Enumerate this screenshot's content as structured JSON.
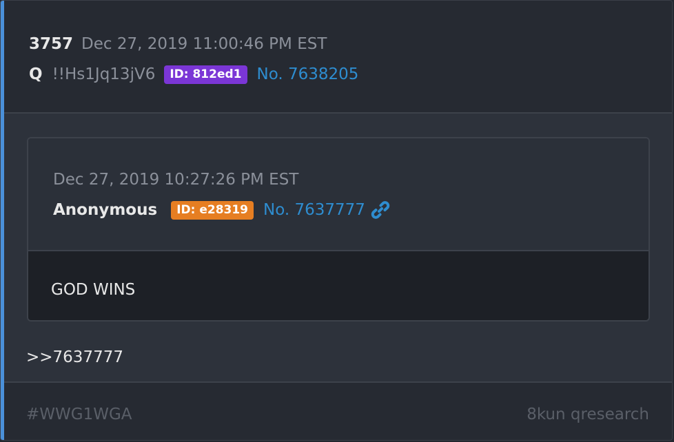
{
  "post": {
    "number": "3757",
    "date": "Dec 27, 2019 11:00:46 PM EST",
    "author": "Q",
    "tripcode": "!!Hs1Jq13jV6",
    "id_label": "ID: 812ed1",
    "id_color": "#7b36d6",
    "post_link": "No. 7638205"
  },
  "quote": {
    "date": "Dec 27, 2019 10:27:26 PM EST",
    "author": "Anonymous",
    "id_label": "ID: e28319",
    "id_color": "#e67e22",
    "post_link": "No. 7637777",
    "link_icon": "link-icon",
    "text": "GOD WINS"
  },
  "reply_ref": ">>7637777",
  "footer": {
    "hashtag": "#WWG1WGA",
    "board": "8kun qresearch"
  },
  "colors": {
    "accent": "#4a90d9",
    "link": "#2e8dd0"
  }
}
